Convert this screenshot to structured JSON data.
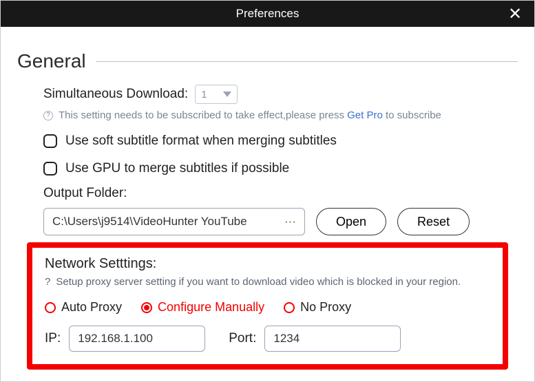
{
  "titlebar": {
    "title": "Preferences",
    "close_label": "✕"
  },
  "general": {
    "heading": "General",
    "simultaneous": {
      "label": "Simultaneous Download:",
      "value": "1",
      "hint_prefix": "This setting needs to be subscribed to take effect,please press ",
      "hint_link": "Get Pro",
      "hint_suffix": " to subscribe",
      "qmark": "?"
    },
    "soft_subtitle_label": "Use soft subtitle format when merging subtitles",
    "gpu_subtitle_label": "Use GPU to merge subtitles if possible",
    "output": {
      "label": "Output Folder:",
      "path": "C:\\Users\\j9514\\VideoHunter YouTube",
      "browse_dots": "···",
      "open_label": "Open",
      "reset_label": "Reset"
    }
  },
  "network": {
    "heading": "Network Setttings:",
    "hint": "Setup proxy server setting if you want to download video which is blocked in your region.",
    "qmark": "?",
    "options": {
      "auto": "Auto Proxy",
      "manual": "Configure Manually",
      "none": "No Proxy"
    },
    "ip_label": "IP:",
    "ip_value": "192.168.1.100",
    "port_label": "Port:",
    "port_value": "1234"
  }
}
